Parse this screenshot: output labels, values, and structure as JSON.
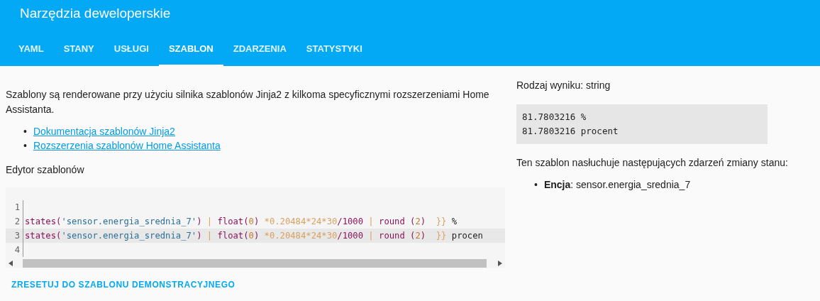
{
  "header": {
    "title": "Narzędzia deweloperskie"
  },
  "tabs": [
    {
      "label": "YAML",
      "selected": false
    },
    {
      "label": "STANY",
      "selected": false
    },
    {
      "label": "USŁUGI",
      "selected": false
    },
    {
      "label": "SZABLON",
      "selected": true
    },
    {
      "label": "ZDARZENIA",
      "selected": false
    },
    {
      "label": "STATYSTYKI",
      "selected": false
    }
  ],
  "intro": "Szablony są renderowane przy użyciu silnika szablonów Jinja2 z kilkoma specyficznymi rozszerzeniami Home Assistanta.",
  "links": [
    {
      "bullet": "•",
      "label": "Dokumentacja szablonów Jinja2"
    },
    {
      "bullet": "•",
      "label": "Rozszerzenia szablonów Home Assistanta"
    }
  ],
  "editor_label": "Edytor szablonów",
  "editor": {
    "lines": [
      {
        "number": "1",
        "active": false
      },
      {
        "number": "2",
        "active": false,
        "tokens": [
          {
            "kind": "fn",
            "text": "states("
          },
          {
            "kind": "str",
            "text": "'sensor.energia_srednia_7'"
          },
          {
            "kind": "fn",
            "text": ") "
          },
          {
            "kind": "op",
            "text": "|"
          },
          {
            "kind": "fn",
            "text": " float("
          },
          {
            "kind": "num",
            "text": "0"
          },
          {
            "kind": "fn",
            "text": ") "
          },
          {
            "kind": "op",
            "text": "*0.20484*24*30"
          },
          {
            "kind": "fn",
            "text": "/1000 "
          },
          {
            "kind": "op",
            "text": "|"
          },
          {
            "kind": "fn",
            "text": " round ("
          },
          {
            "kind": "num",
            "text": "2"
          },
          {
            "kind": "fn",
            "text": ")  "
          },
          {
            "kind": "op",
            "text": "}}"
          },
          {
            "kind": "text",
            "text": " %"
          }
        ]
      },
      {
        "number": "3",
        "active": true,
        "tokens": [
          {
            "kind": "fn",
            "text": "states("
          },
          {
            "kind": "str",
            "text": "'sensor.energia_srednia_7'"
          },
          {
            "kind": "fn",
            "text": ") "
          },
          {
            "kind": "op",
            "text": "|"
          },
          {
            "kind": "fn",
            "text": " float("
          },
          {
            "kind": "num",
            "text": "0"
          },
          {
            "kind": "fn",
            "text": ") "
          },
          {
            "kind": "op",
            "text": "*0.20484*24*30"
          },
          {
            "kind": "fn",
            "text": "/1000 "
          },
          {
            "kind": "op",
            "text": "|"
          },
          {
            "kind": "fn",
            "text": " round ("
          },
          {
            "kind": "num",
            "text": "2"
          },
          {
            "kind": "fn",
            "text": ")  "
          },
          {
            "kind": "op",
            "text": "}}"
          },
          {
            "kind": "text",
            "text": " procen"
          }
        ]
      },
      {
        "number": "4",
        "active": false
      }
    ]
  },
  "reset_button": "ZRESETUJ DO SZABLONU DEMONSTRACYJNEGO",
  "result_type": "Rodzaj wyniku: string",
  "result_lines": [
    "81.7803216 %",
    "81.7803216 procent"
  ],
  "listens_label": "Ten szablon nasłuchuje następujących zdarzeń zmiany stanu:",
  "listeners": [
    {
      "bullet": "•",
      "kind_label": "Encja",
      "entity": ": sensor.energia_srednia_7"
    }
  ]
}
